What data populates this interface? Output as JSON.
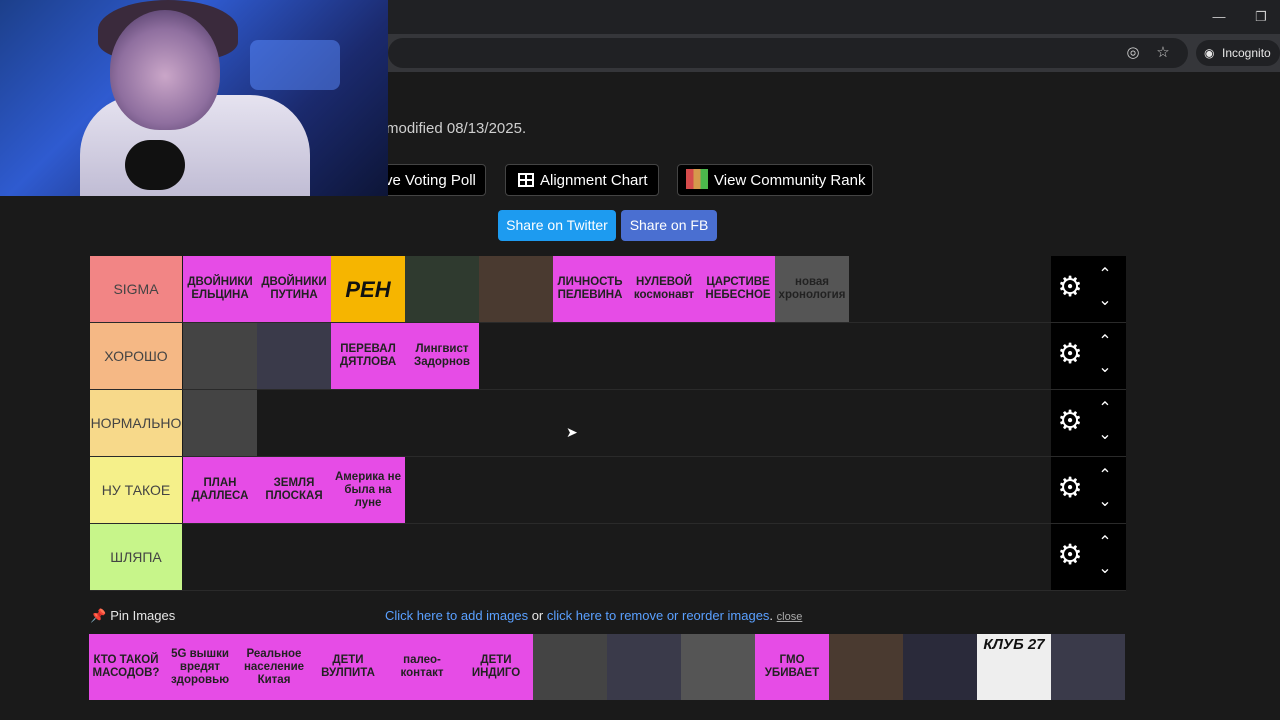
{
  "browser": {
    "incognito_label": "Incognito",
    "minimize_icon": "minimize-icon",
    "restore_icon": "restore-icon",
    "eye_off_icon": "eye-off-icon",
    "star_icon": "star-icon"
  },
  "header": {
    "modified_text": "modified 08/13/2025.",
    "buttons": {
      "voting_poll": "ve Voting Poll",
      "alignment_chart": "Alignment Chart",
      "community_rank": "View Community Rank"
    },
    "share_twitter": "Share on Twitter",
    "share_fb": "Share on FB"
  },
  "colors": {
    "item_pink": "#e64ce6",
    "twitter": "#1d9bf0",
    "facebook": "#4a6fd1"
  },
  "tiers": [
    {
      "label": "SIGMA",
      "color": "#f28585",
      "items": [
        {
          "text": "ДВОЙНИКИ ЕЛЬЦИНА",
          "kind": "text"
        },
        {
          "text": "ДВОЙНИКИ ПУТИНА",
          "kind": "text"
        },
        {
          "text": "РЕН",
          "kind": "image"
        },
        {
          "text": "",
          "kind": "image"
        },
        {
          "text": "",
          "kind": "image"
        },
        {
          "text": "ЛИЧНОСТЬ ПЕЛЕВИНА",
          "kind": "text"
        },
        {
          "text": "НУЛЕВОЙ космонавт",
          "kind": "text"
        },
        {
          "text": "ЦАРСТИВЕ НЕБЕСНОЕ",
          "kind": "text"
        },
        {
          "text": "новая хронология",
          "kind": "image"
        }
      ]
    },
    {
      "label": "ХОРОШО",
      "color": "#f5b885",
      "items": [
        {
          "text": "",
          "kind": "image"
        },
        {
          "text": "",
          "kind": "image"
        },
        {
          "text": "ПЕРЕВАЛ ДЯТЛОВА",
          "kind": "text"
        },
        {
          "text": "Лингвист Задорнов",
          "kind": "text"
        }
      ]
    },
    {
      "label": "НОРМАЛЬНО",
      "color": "#f7d98a",
      "items": [
        {
          "text": "",
          "kind": "image"
        }
      ]
    },
    {
      "label": "НУ ТАКОЕ",
      "color": "#f5f08a",
      "items": [
        {
          "text": "ПЛАН ДАЛЛЕСА",
          "kind": "text"
        },
        {
          "text": "ЗЕМЛЯ ПЛОСКАЯ",
          "kind": "text"
        },
        {
          "text": "Америка не была на луне",
          "kind": "text"
        }
      ]
    },
    {
      "label": "ШЛЯПА",
      "color": "#c7f58a",
      "items": []
    }
  ],
  "pin": {
    "label": "Pin Images",
    "add_link": "Click here to add images",
    "or_text": "or",
    "remove_link": "click here to remove or reorder images",
    "period": ".",
    "close": "close"
  },
  "pool": [
    {
      "text": "КТО ТАКОЙ МАСОДОВ?",
      "kind": "text"
    },
    {
      "text": "5G вышки вредят здоровью",
      "kind": "text"
    },
    {
      "text": "Реальное население Китая",
      "kind": "text"
    },
    {
      "text": "ДЕТИ ВУЛПИТА",
      "kind": "text"
    },
    {
      "text": "палео-контакт",
      "kind": "text"
    },
    {
      "text": "ДЕТИ ИНДИГО",
      "kind": "text"
    },
    {
      "text": "",
      "kind": "image"
    },
    {
      "text": "",
      "kind": "image"
    },
    {
      "text": "",
      "kind": "image"
    },
    {
      "text": "ГМО УБИВАЕТ",
      "kind": "text"
    },
    {
      "text": "",
      "kind": "image"
    },
    {
      "text": "",
      "kind": "image"
    },
    {
      "text": "КЛУБ 27",
      "kind": "image"
    },
    {
      "text": "",
      "kind": "image"
    }
  ]
}
